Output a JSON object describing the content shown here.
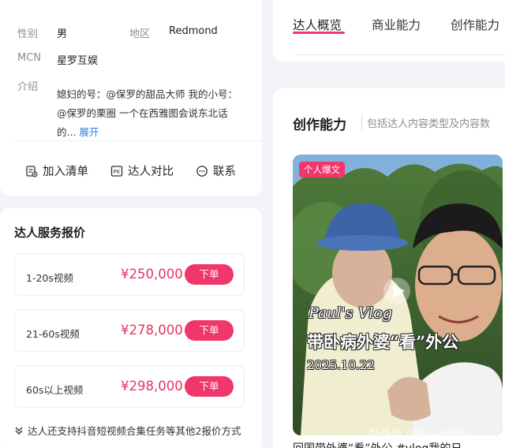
{
  "profile": {
    "gender_label": "性别",
    "gender_value": "男",
    "region_label": "地区",
    "region_value": "Redmond",
    "mcn_label": "MCN",
    "mcn_value": "星罗互娱",
    "intro_label": "介绍",
    "intro_text": "媳妇的号：@保罗的甜品大师 我的小号：@保罗的栗圈 一个在西雅图会说东北话的...",
    "intro_more": "展开",
    "actions": {
      "add_to_list": "加入清单",
      "compare": "达人对比",
      "contact": "联系"
    }
  },
  "pricing": {
    "title": "达人服务报价",
    "rows": [
      {
        "duration": "1-20s视频",
        "price": "¥250,000",
        "order_label": "下单"
      },
      {
        "duration": "21-60s视频",
        "price": "¥278,000",
        "order_label": "下单"
      },
      {
        "duration": "60s以上视频",
        "price": "¥298,000",
        "order_label": "下单"
      }
    ],
    "more_formats": "达人还支持抖音短视频合集任务等其他2报价方式"
  },
  "tabs": [
    "达人概览",
    "商业能力",
    "创作能力"
  ],
  "creation": {
    "title": "创作能力",
    "subtitle": "包括达人内容类型及内容数",
    "video": {
      "badge": "个人爆文",
      "overlay_line1": "Paul's Vlog",
      "overlay_line2": "带卧病外婆“看”外公",
      "overlay_line3": "2025.10.22",
      "caption": "回国带外婆“看”外公 #vlog我的日",
      "watermark": "快传号 / 周小小识识"
    }
  },
  "colors": {
    "accent": "#f0366b",
    "price": "#e8335f",
    "link": "#2f7ee6"
  }
}
